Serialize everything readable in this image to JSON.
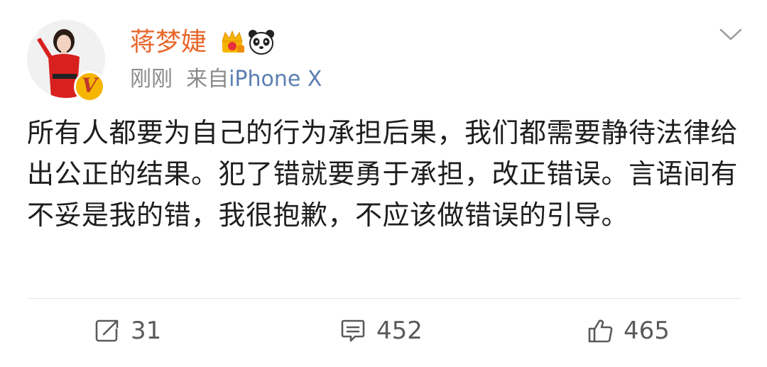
{
  "user": {
    "name": "蒋梦婕",
    "badge_letter": "V",
    "crown_icon": "crown-icon",
    "panda_icon": "panda-icon"
  },
  "meta": {
    "time": "刚刚",
    "source_prefix": "来自",
    "source": "iPhone X"
  },
  "post": {
    "text": "所有人都要为自己的行为承担后果，我们都需要静待法律给出公正的结果。犯了错就要勇于承担，改正错误。言语间有不妥是我的错，我很抱歉，不应该做错误的引导。"
  },
  "actions": {
    "repost_count": "31",
    "comment_count": "452",
    "like_count": "465"
  },
  "colors": {
    "username": "#e8682c",
    "source_link": "#5b7fb2",
    "meta": "#8b8b8b",
    "badge": "#f6b500"
  }
}
